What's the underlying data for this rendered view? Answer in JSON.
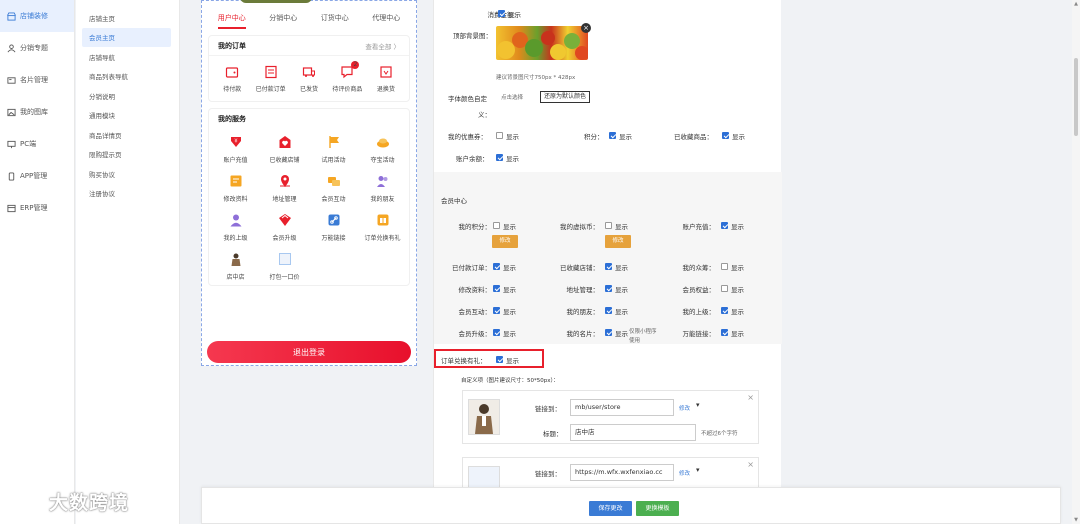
{
  "primary_nav": [
    {
      "label": "店铺装修",
      "icon": "shop-icon",
      "active": true
    },
    {
      "label": "分销专题",
      "icon": "share-icon",
      "active": false
    },
    {
      "label": "名片管理",
      "icon": "card-icon",
      "active": false
    },
    {
      "label": "我的图库",
      "icon": "image-icon",
      "active": false
    },
    {
      "label": "PC端",
      "icon": "monitor-icon",
      "active": false
    },
    {
      "label": "APP管理",
      "icon": "app-icon",
      "active": false
    },
    {
      "label": "ERP管理",
      "icon": "erp-icon",
      "active": false
    }
  ],
  "secondary_nav": [
    "店铺主页",
    "会员主页",
    "店铺导航",
    "商品列表导航",
    "分销说明",
    "通用模块",
    "商品详情页",
    "限购提示页",
    "购买协议",
    "注册协议"
  ],
  "preview": {
    "tabs": [
      "用户中心",
      "分销中心",
      "订货中心",
      "代理中心"
    ],
    "orders": {
      "title": "我的订单",
      "more": "查看全部 〉",
      "items": [
        {
          "label": "待付款",
          "icon": "wallet-icon"
        },
        {
          "label": "已付款订单",
          "icon": "order-icon"
        },
        {
          "label": "已发货",
          "icon": "truck-icon"
        },
        {
          "label": "待评价商品",
          "icon": "comment-icon",
          "badge": "2"
        },
        {
          "label": "退换货",
          "icon": "return-icon"
        }
      ]
    },
    "services": {
      "title": "我的服务",
      "items": [
        {
          "label": "账户充值",
          "icon": "recharge-icon",
          "color": "#e8202c"
        },
        {
          "label": "已收藏店铺",
          "icon": "favorite-shop-icon",
          "color": "#e8202c"
        },
        {
          "label": "试用活动",
          "icon": "flag-icon",
          "color": "#f5a623"
        },
        {
          "label": "夺宝活动",
          "icon": "treasure-icon",
          "color": "#f5a623"
        },
        {
          "label": "修改资料",
          "icon": "edit-profile-icon",
          "color": "#f5a623"
        },
        {
          "label": "地址管理",
          "icon": "location-icon",
          "color": "#e8202c"
        },
        {
          "label": "会员互动",
          "icon": "interaction-icon",
          "color": "#f5a623"
        },
        {
          "label": "我的朋友",
          "icon": "friends-icon",
          "color": "#8e6fd8"
        },
        {
          "label": "我的上级",
          "icon": "superior-icon",
          "color": "#8e6fd8"
        },
        {
          "label": "会员升级",
          "icon": "upgrade-icon",
          "color": "#e8202c"
        },
        {
          "label": "万能链接",
          "icon": "link-icon",
          "color": "#3a7bd5"
        },
        {
          "label": "订单兑换有礼",
          "icon": "gift-icon",
          "color": "#f5a623"
        },
        {
          "label": "店中店",
          "icon": "store-photo-icon",
          "color": "#8a6a4a"
        },
        {
          "label": "打包一口价",
          "icon": "package-icon",
          "color": "#a8c8f0"
        }
      ]
    },
    "logout": "退出登录"
  },
  "settings": {
    "spend_label": "消费金额：",
    "show": "显示",
    "bg_label": "顶部背景图：",
    "bg_hint": "建议背景图尺寸750px * 428px",
    "font_color_label": "字体颜色自定",
    "font_color_label2": "义：",
    "click_select": "点击选择",
    "reset_color": "还原为默认颜色",
    "my_coupons": "我的优惠券：",
    "points": "积分：",
    "fav_goods": "已收藏商品：",
    "balance": "账户余额：",
    "member_center": "会员中心",
    "my_points": "我的积分：",
    "my_virtual": "我的虚拟币：",
    "recharge": "账户充值：",
    "edit": "修改",
    "paid_orders": "已付款订单：",
    "fav_shop": "已收藏店铺：",
    "my_crowd": "我的众筹：",
    "edit_profile": "修改资料：",
    "address": "地址管理：",
    "member_rights": "会员权益：",
    "member_interact": "会员互动：",
    "my_friends": "我的朋友：",
    "my_superior": "我的上级：",
    "member_upgrade": "会员升级：",
    "my_card": "我的名片：",
    "miniapp_only": "仅限小程序",
    "use": "使用",
    "universal_link": "万能链接：",
    "order_gift": "订单兑换有礼：",
    "custom_item": "自定义项（图片建议尺寸：50*50px）：",
    "link_to": "链接到：",
    "link1_value": "mb/user/store",
    "modify": "修改",
    "title_label": "标题：",
    "title_value": "店中店",
    "max_chars": "不超过6个字符",
    "link2_value": "https://m.wfx.wxfenxiao.cc",
    "save": "保存更改",
    "change_tpl": "更换模板"
  },
  "watermark": "大数跨境"
}
